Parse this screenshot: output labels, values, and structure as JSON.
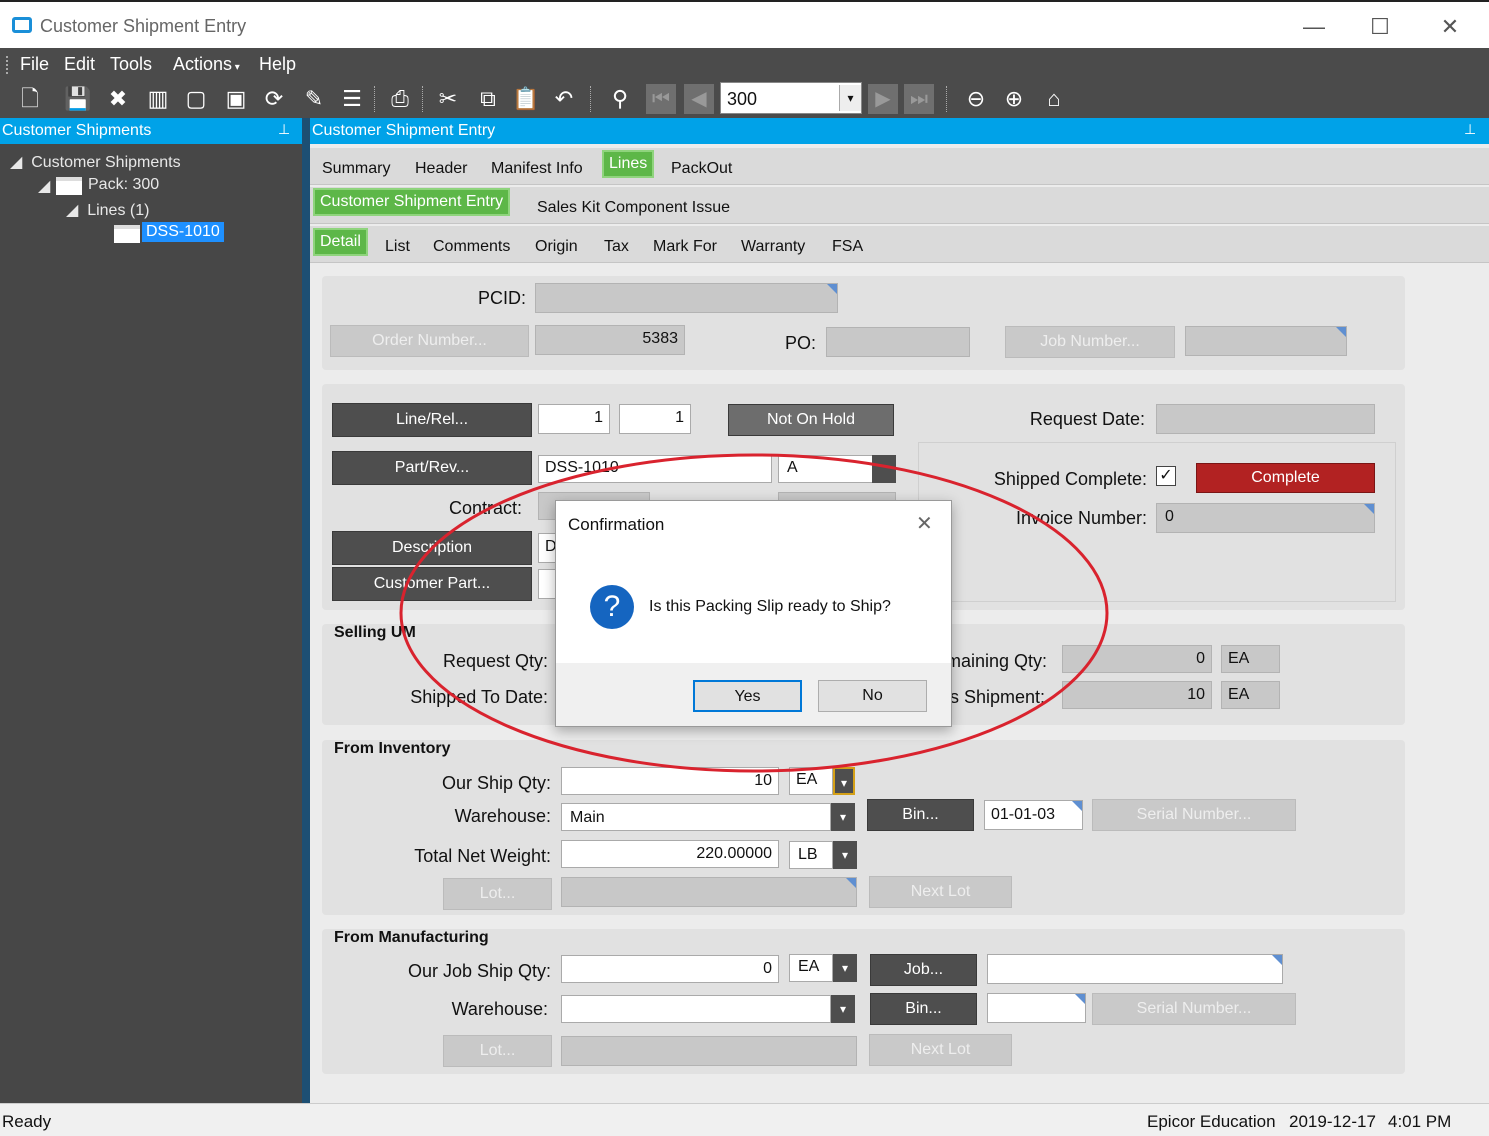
{
  "window": {
    "title": "Customer Shipment Entry"
  },
  "menu": {
    "file": "File",
    "edit": "Edit",
    "tools": "Tools",
    "actions": "Actions",
    "help": "Help"
  },
  "toolbar": {
    "record_value": "300"
  },
  "left": {
    "header": "Customer Shipments",
    "tree": {
      "root": "Customer Shipments",
      "pack": "Pack: 300",
      "lines": "Lines (1)",
      "line": "DSS-1010"
    }
  },
  "right": {
    "header": "Customer Shipment Entry",
    "tabs1": [
      "Summary",
      "Header",
      "Manifest Info",
      "Lines",
      "PackOut"
    ],
    "tabs2": [
      "Customer Shipment Entry",
      "Sales Kit Component Issue"
    ],
    "tabs3": [
      "Detail",
      "List",
      "Comments",
      "Origin",
      "Tax",
      "Mark For",
      "Warranty",
      "FSA"
    ]
  },
  "form": {
    "pcid_label": "PCID:",
    "order_number_btn": "Order Number...",
    "order_number_value": "5383",
    "po_label": "PO:",
    "job_number_btn": "Job Number...",
    "linerel_btn": "Line/Rel...",
    "line_value": "1",
    "rel_value": "1",
    "hold_btn": "Not On Hold",
    "request_date_label": "Request Date:",
    "partrev_btn": "Part/Rev...",
    "part_value": "DSS-1010",
    "rev_value": "A",
    "contract_label": "Contract:",
    "shipped_complete_label": "Shipped Complete:",
    "complete_btn": "Complete",
    "invoice_label": "Invoice Number:",
    "invoice_value": "0",
    "description_btn": "Description",
    "description_value": "D",
    "customer_part_btn": "Customer Part...",
    "selling_um_title": "Selling UM",
    "request_qty_label": "Request Qty:",
    "shipped_to_date_label": "Shipped To Date:",
    "remaining_qty_label": "maining Qty:",
    "remaining_qty_value": "0",
    "remaining_uom": "EA",
    "this_shipment_label": "s Shipment:",
    "this_shipment_value": "10",
    "this_shipment_uom": "EA",
    "from_inventory_title": "From Inventory",
    "our_ship_qty_label": "Our Ship Qty:",
    "our_ship_qty_value": "10",
    "our_ship_uom": "EA",
    "warehouse_label": "Warehouse:",
    "warehouse_value": "Main",
    "bin_btn": "Bin...",
    "bin_value": "01-01-03",
    "serial_btn": "Serial Number...",
    "net_weight_label": "Total Net Weight:",
    "net_weight_value": "220.00000",
    "weight_uom": "LB",
    "lot_btn": "Lot...",
    "next_lot_btn": "Next Lot",
    "from_mfg_title": "From Manufacturing",
    "job_ship_qty_label": "Our Job Ship Qty:",
    "job_ship_qty_value": "0",
    "job_ship_uom": "EA",
    "mfg_warehouse_label": "Warehouse:",
    "job_btn": "Job...",
    "mfg_bin_btn": "Bin...",
    "mfg_serial_btn": "Serial Number...",
    "mfg_lot_btn": "Lot...",
    "mfg_next_lot_btn": "Next Lot"
  },
  "dialog": {
    "title": "Confirmation",
    "message": "Is this Packing Slip ready to Ship?",
    "yes": "Yes",
    "no": "No"
  },
  "status": {
    "left": "Ready",
    "company": "Epicor Education",
    "date": "2019-12-17",
    "time": "4:01 PM"
  },
  "colors": {
    "accent": "#00a2e8",
    "active_tab": "#5db748",
    "complete": "#b22222",
    "annotation": "#d9232e"
  }
}
